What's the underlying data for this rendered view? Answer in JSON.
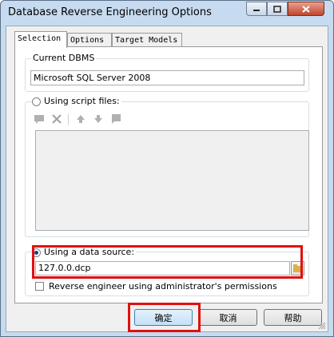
{
  "window": {
    "title": "Database Reverse Engineering Options",
    "controls": [
      "minimize",
      "maximize",
      "close"
    ]
  },
  "tabs": [
    {
      "label": "Selection",
      "active": true
    },
    {
      "label": "Options",
      "active": false
    },
    {
      "label": "Target Models",
      "active": false
    }
  ],
  "dbms": {
    "group_label": "Current DBMS",
    "value": "Microsoft SQL Server 2008"
  },
  "script_files": {
    "label": "Using script files:",
    "selected": false,
    "toolbar_icons": [
      "add-file-icon",
      "delete-icon",
      "move-up-icon",
      "move-down-icon",
      "properties-icon"
    ]
  },
  "data_source": {
    "label": "Using a data source:",
    "selected": true,
    "value": "127.0.0.dcp"
  },
  "admin_permissions": {
    "label": "Reverse engineer using administrator's permissions",
    "checked": false
  },
  "buttons": {
    "ok": "确定",
    "cancel": "取消",
    "help": "帮助"
  },
  "colors": {
    "highlight": "#e01010",
    "title_bar": "#c6dbef"
  }
}
